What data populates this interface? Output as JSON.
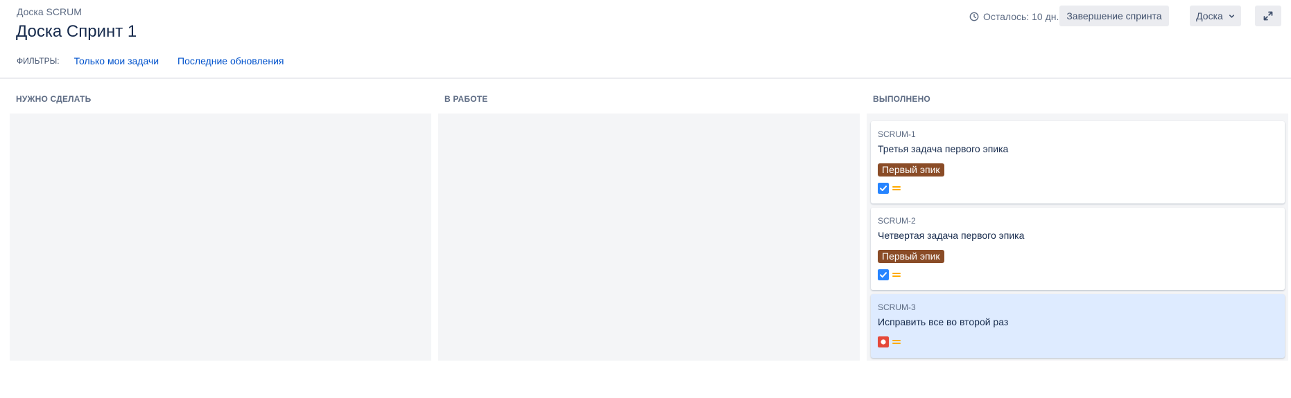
{
  "header": {
    "breadcrumb": "Доска SCRUM",
    "title": "Доска Спринт 1",
    "filters_label": "ФИЛЬТРЫ:",
    "filters": [
      "Только мои задачи",
      "Последние обновления"
    ],
    "time_left": "Осталось: 10 дн.",
    "complete_sprint_label": "Завершение спринта",
    "board_menu_label": "Доска"
  },
  "columns": [
    {
      "title": "НУЖНО СДЕЛАТЬ"
    },
    {
      "title": "В РАБОТЕ"
    },
    {
      "title": "ВЫПОЛНЕНО"
    }
  ],
  "cards": [
    {
      "key": "SCRUM-1",
      "summary": "Третья задача первого эпика",
      "epic": "Первый эпик",
      "type_icon": "task-checkbox-icon",
      "priority_icon": "priority-medium-icon"
    },
    {
      "key": "SCRUM-2",
      "summary": "Четвертая задача первого эпика",
      "epic": "Первый эпик",
      "type_icon": "task-checkbox-icon",
      "priority_icon": "priority-medium-icon"
    },
    {
      "key": "SCRUM-3",
      "summary": "Исправить все во второй раз",
      "epic": "",
      "type_icon": "bug-icon",
      "priority_icon": "priority-medium-icon"
    }
  ],
  "colors": {
    "link": "#0052cc",
    "epic_bg": "#8a4c27",
    "task_icon": "#2684ff",
    "bug_icon": "#e5493a",
    "priority_medium": "#ffab00",
    "selected_card": "#deebff",
    "column_bg": "#f4f5f7"
  }
}
